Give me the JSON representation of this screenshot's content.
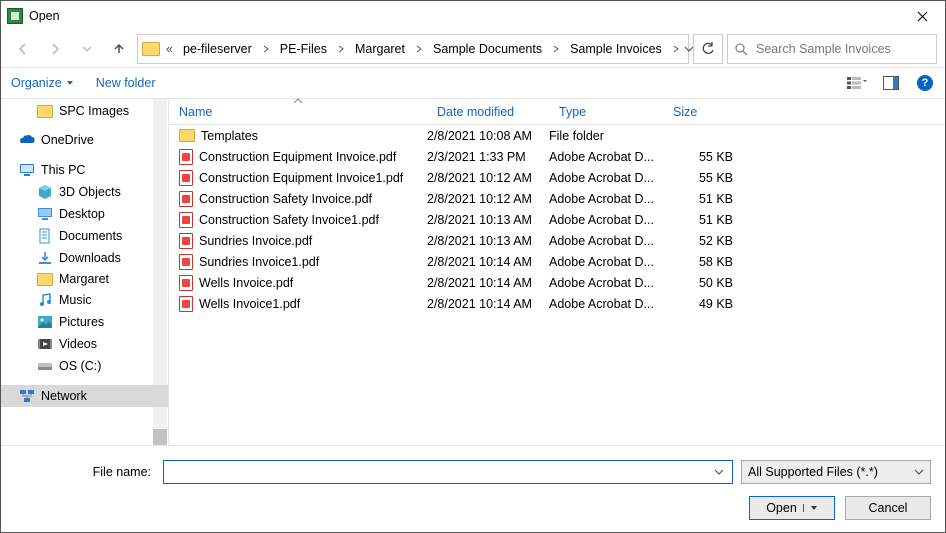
{
  "window": {
    "title": "Open"
  },
  "breadcrumb": {
    "prefix": "«",
    "items": [
      "pe-fileserver",
      "PE-Files",
      "Margaret",
      "Sample Documents",
      "Sample Invoices"
    ]
  },
  "search": {
    "placeholder": "Search Sample Invoices"
  },
  "toolbar": {
    "organize": "Organize",
    "new_folder": "New folder"
  },
  "tree": {
    "top": [
      {
        "label": "SPC Images",
        "icon": "folder"
      }
    ],
    "sections": [
      {
        "label": "OneDrive",
        "icon": "onedrive"
      },
      {
        "label": "This PC",
        "icon": "pc"
      }
    ],
    "thispc": [
      {
        "label": "3D Objects",
        "icon": "3d"
      },
      {
        "label": "Desktop",
        "icon": "desktop"
      },
      {
        "label": "Documents",
        "icon": "docs"
      },
      {
        "label": "Downloads",
        "icon": "downloads"
      },
      {
        "label": "Margaret",
        "icon": "folder"
      },
      {
        "label": "Music",
        "icon": "music"
      },
      {
        "label": "Pictures",
        "icon": "pictures"
      },
      {
        "label": "Videos",
        "icon": "videos"
      },
      {
        "label": "OS (C:)",
        "icon": "drive"
      }
    ],
    "bottom": [
      {
        "label": "Network",
        "icon": "network",
        "selected": true
      }
    ]
  },
  "columns": {
    "name": "Name",
    "date": "Date modified",
    "type": "Type",
    "size": "Size"
  },
  "rows": [
    {
      "name": "Templates",
      "date": "2/8/2021 10:08 AM",
      "type": "File folder",
      "size": "",
      "kind": "folder"
    },
    {
      "name": "Construction Equipment Invoice.pdf",
      "date": "2/3/2021 1:33 PM",
      "type": "Adobe Acrobat D...",
      "size": "55 KB",
      "kind": "pdf"
    },
    {
      "name": "Construction Equipment Invoice1.pdf",
      "date": "2/8/2021 10:12 AM",
      "type": "Adobe Acrobat D...",
      "size": "55 KB",
      "kind": "pdf"
    },
    {
      "name": "Construction Safety Invoice.pdf",
      "date": "2/8/2021 10:12 AM",
      "type": "Adobe Acrobat D...",
      "size": "51 KB",
      "kind": "pdf"
    },
    {
      "name": "Construction Safety Invoice1.pdf",
      "date": "2/8/2021 10:13 AM",
      "type": "Adobe Acrobat D...",
      "size": "51 KB",
      "kind": "pdf"
    },
    {
      "name": "Sundries Invoice.pdf",
      "date": "2/8/2021 10:13 AM",
      "type": "Adobe Acrobat D...",
      "size": "52 KB",
      "kind": "pdf"
    },
    {
      "name": "Sundries Invoice1.pdf",
      "date": "2/8/2021 10:14 AM",
      "type": "Adobe Acrobat D...",
      "size": "58 KB",
      "kind": "pdf"
    },
    {
      "name": "Wells Invoice.pdf",
      "date": "2/8/2021 10:14 AM",
      "type": "Adobe Acrobat D...",
      "size": "50 KB",
      "kind": "pdf"
    },
    {
      "name": "Wells Invoice1.pdf",
      "date": "2/8/2021 10:14 AM",
      "type": "Adobe Acrobat D...",
      "size": "49 KB",
      "kind": "pdf"
    }
  ],
  "footer": {
    "filename_label": "File name:",
    "filename_value": "",
    "filter": "All Supported Files (*.*)",
    "open": "Open",
    "cancel": "Cancel"
  }
}
